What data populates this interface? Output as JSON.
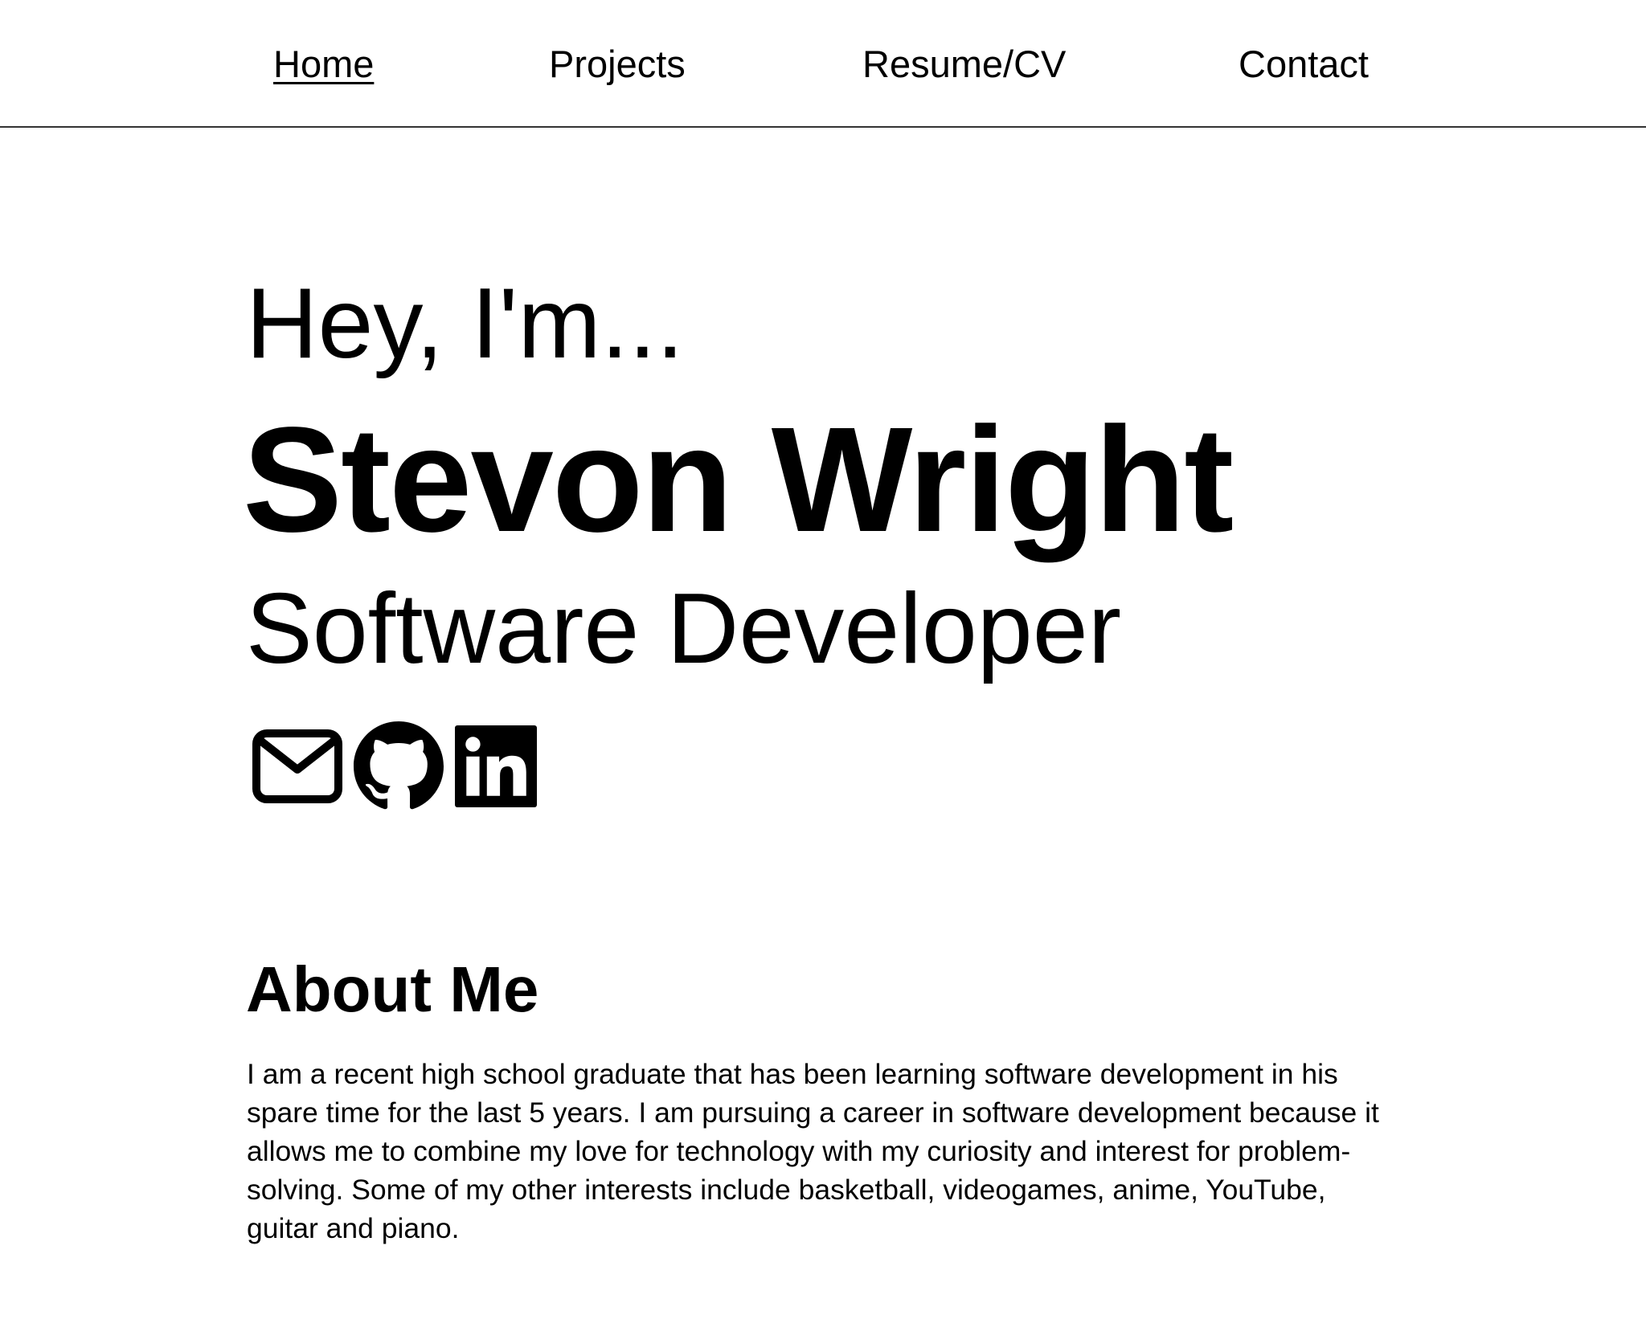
{
  "nav": {
    "links": [
      {
        "label": "Home",
        "active": true
      },
      {
        "label": "Projects",
        "active": false
      },
      {
        "label": "Resume/CV",
        "active": false
      },
      {
        "label": "Contact",
        "active": false
      }
    ]
  },
  "hero": {
    "greeting": "Hey, I'm...",
    "name": "Stevon Wright",
    "role": "Software Developer",
    "social_icons": [
      "envelope-icon",
      "github-icon",
      "linkedin-icon"
    ]
  },
  "about": {
    "title": "About Me",
    "body": "I am a recent high school graduate that has been learning software development in his spare time for the last 5 years. I am pursuing a career in software development because it allows me to combine my love for technology with my curiosity and interest for problem-solving. Some of my other interests include basketball, videogames, anime, YouTube, guitar and piano."
  },
  "colors": {
    "text": "#000000",
    "background": "#ffffff",
    "nav_border": "#333333"
  }
}
